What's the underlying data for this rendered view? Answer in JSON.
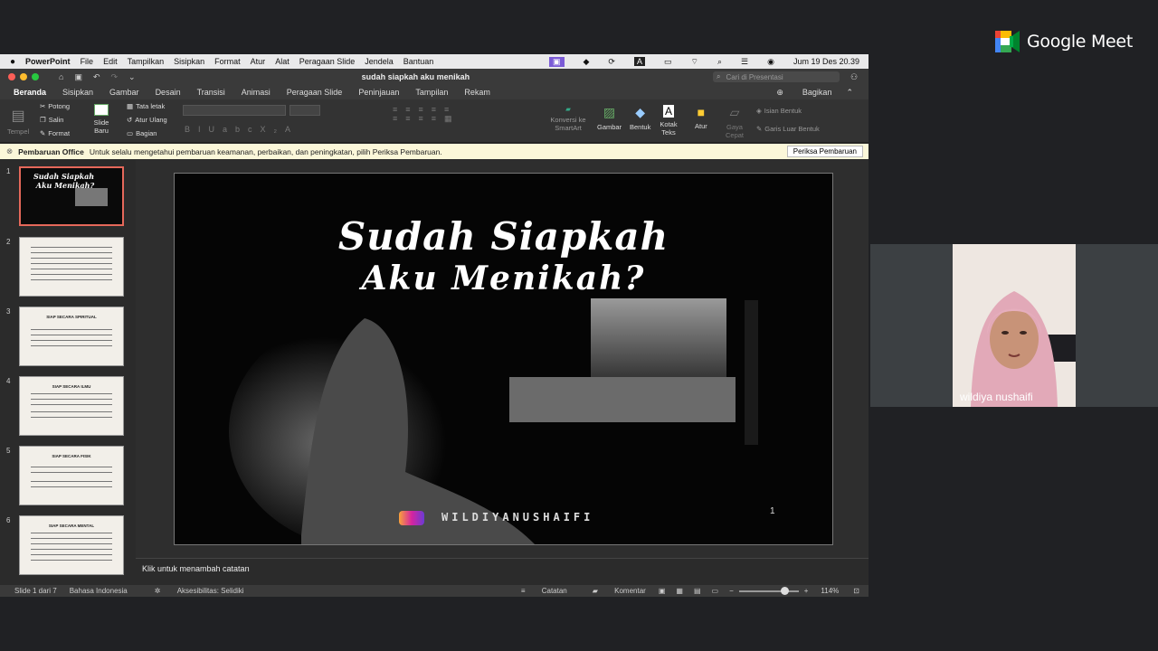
{
  "meet": {
    "brand": "Google Meet",
    "participant_name": "wildiya nushaifi"
  },
  "menubar": {
    "app": "PowerPoint",
    "items": [
      "File",
      "Edit",
      "Tampilkan",
      "Sisipkan",
      "Format",
      "Atur",
      "Alat",
      "Peragaan Slide",
      "Jendela",
      "Bantuan"
    ],
    "datetime": "Jum 19 Des  20.39"
  },
  "window": {
    "title": "sudah siapkah aku menikah",
    "search_placeholder": "Cari di Presentasi"
  },
  "tabs": {
    "items": [
      "Beranda",
      "Sisipkan",
      "Gambar",
      "Desain",
      "Transisi",
      "Animasi",
      "Peragaan Slide",
      "Peninjauan",
      "Tampilan",
      "Rekam"
    ],
    "share": "Bagikan"
  },
  "ribbon": {
    "paste": "Tempel",
    "cut": "Potong",
    "copy": "Salin",
    "format": "Format",
    "new_slide": "Slide Baru",
    "layout": "Tata letak",
    "reset": "Atur Ulang",
    "section": "Bagian",
    "smartart": "Konversi ke SmartArt",
    "picture": "Gambar",
    "shapes": "Bentuk",
    "textbox": "Kotak Teks",
    "arrange": "Atur",
    "quick_styles": "Gaya Cepat",
    "shape_fill": "Isian Bentuk",
    "shape_outline": "Garis Luar Bentuk"
  },
  "notice": {
    "title": "Pembaruan Office",
    "text": "Untuk selalu mengetahui pembaruan keamanan, perbaikan, dan peningkatan, pilih Periksa Pembaruan.",
    "button": "Periksa Pembaruan"
  },
  "thumbnails": [
    {
      "num": "1",
      "title": ""
    },
    {
      "num": "2",
      "title": ""
    },
    {
      "num": "3",
      "title": "SIAP SECARA SPIRITUAL"
    },
    {
      "num": "4",
      "title": "SIAP SECARA ILMU"
    },
    {
      "num": "5",
      "title": "SIAP SECARA FISIK"
    },
    {
      "num": "6",
      "title": "SIAP SECARA  MENTAL"
    }
  ],
  "slide": {
    "title_line1": "Sudah Siapkah",
    "title_line2": "Aku Menikah?",
    "handle": "WILDIYANUSHAIFI",
    "number": "1"
  },
  "notes": {
    "placeholder": "Klik untuk menambah catatan"
  },
  "status": {
    "slide_count": "Slide 1 dari 7",
    "language": "Bahasa Indonesia",
    "accessibility": "Aksesibilitas: Selidiki",
    "notes_btn": "Catatan",
    "comments_btn": "Komentar",
    "zoom": "114%"
  }
}
